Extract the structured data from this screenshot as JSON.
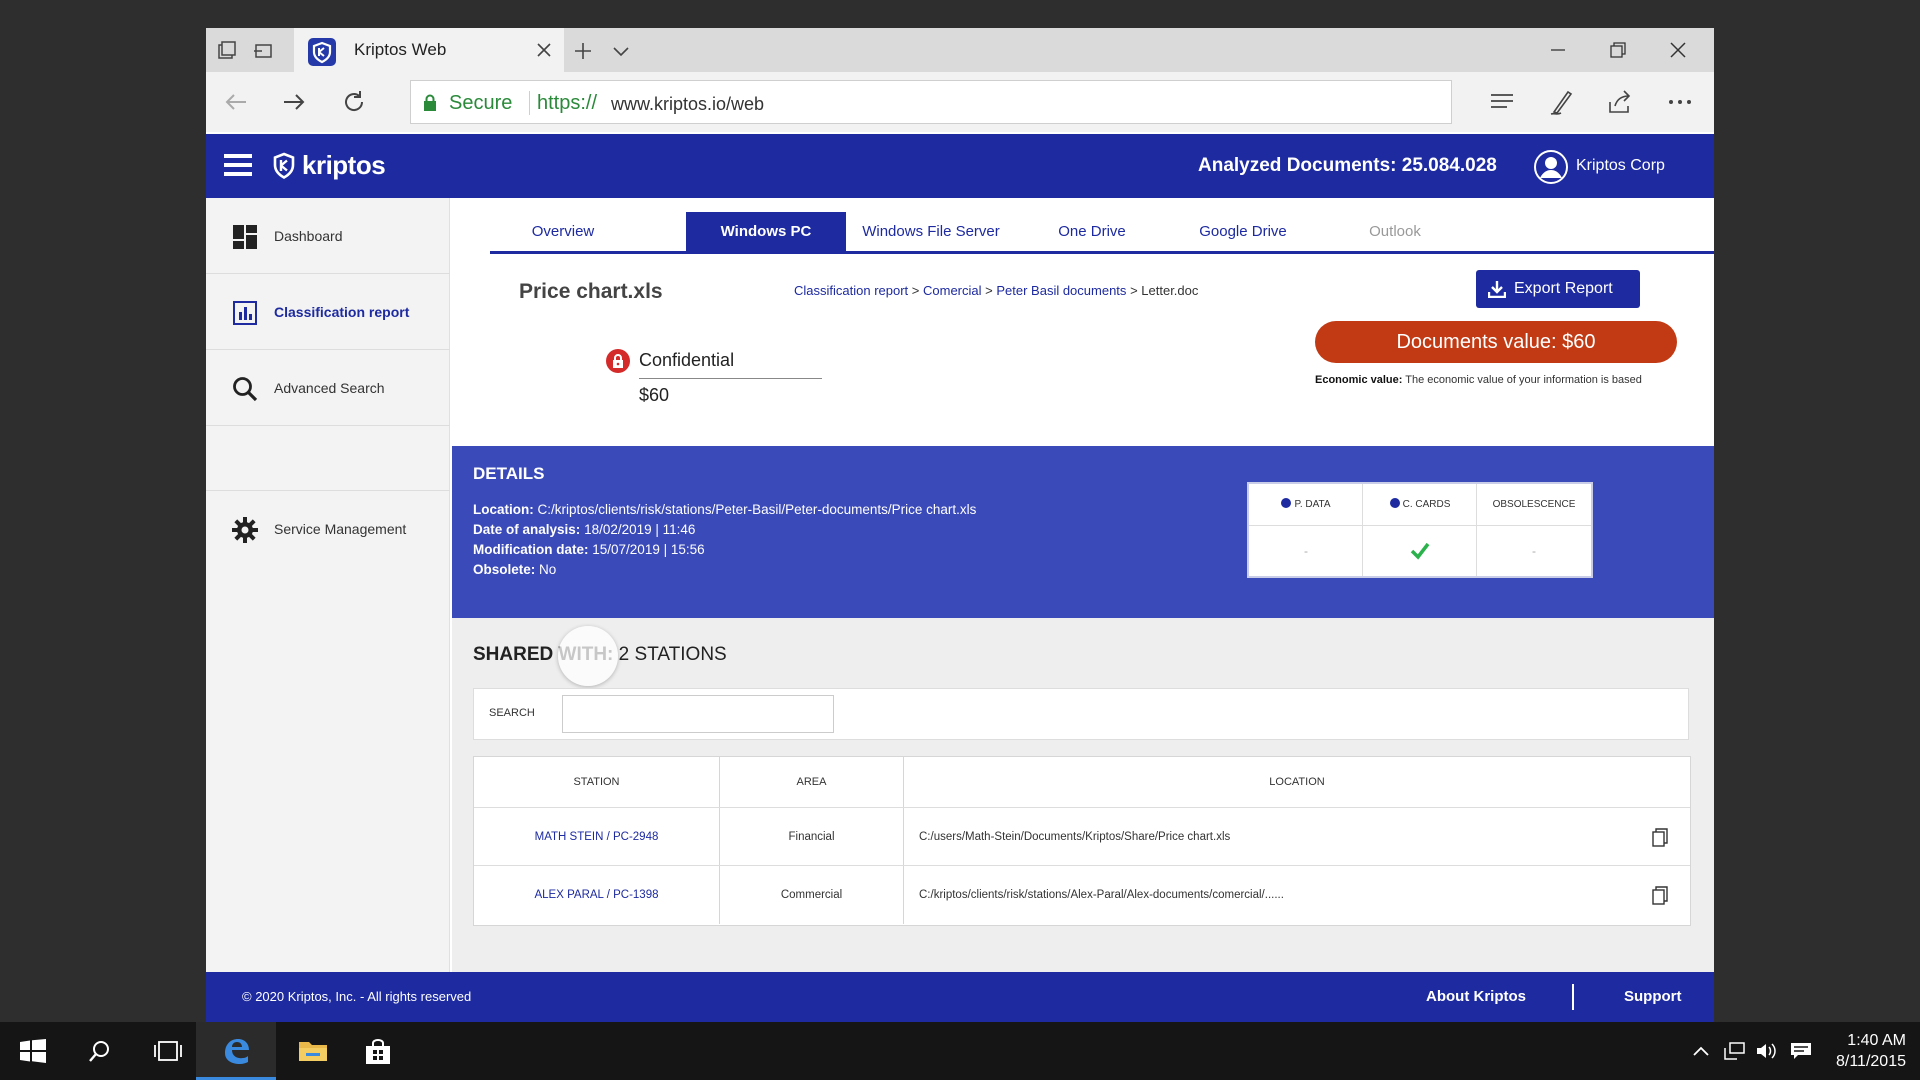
{
  "browser": {
    "tab_title": "Kriptos Web",
    "secure_label": "Secure",
    "url_protocol": "https://",
    "url_host": "www.kriptos.io/web"
  },
  "app": {
    "brand": "kriptos",
    "analyzed_label": "Analyzed Documents: 25.084.028",
    "user_name": "Kriptos Corp"
  },
  "sidebar": {
    "items": [
      {
        "label": "Dashboard",
        "icon": "dashboard-icon"
      },
      {
        "label": "Classification report",
        "icon": "bar-chart-icon",
        "active": true
      },
      {
        "label": "Advanced Search",
        "icon": "search-icon"
      },
      {
        "label": "Service Management",
        "icon": "gear-icon"
      }
    ]
  },
  "tabs": [
    {
      "label": "Overview"
    },
    {
      "label": "Windows PC",
      "active": true
    },
    {
      "label": "Windows File Server"
    },
    {
      "label": "One Drive"
    },
    {
      "label": "Google Drive"
    },
    {
      "label": "Outlook",
      "disabled": true
    }
  ],
  "document": {
    "file_name": "Price chart.xls",
    "breadcrumb": [
      "Classification report",
      "Comercial",
      "Peter Basil documents",
      "Letter.doc"
    ],
    "export_label": "Export Report",
    "classification": "Confidential",
    "value": "$60",
    "documents_value": "Documents value: $60",
    "economic_label": "Economic value:",
    "economic_text": "The economic value of your information is based"
  },
  "details": {
    "title": "DETAILS",
    "location_label": "Location:",
    "location": "C:/kriptos/clients/risk/stations/Peter-Basil/Peter-documents/Price chart.xls",
    "analysis_label": "Date of analysis:",
    "analysis": "18/02/2019 | 11:46",
    "modification_label": "Modification date:",
    "modification": "15/07/2019 | 15:56",
    "obsolete_label": "Obsolete:",
    "obsolete": "No",
    "tags": [
      {
        "label": "P. DATA",
        "value": "-"
      },
      {
        "label": "C. CARDS",
        "value": "check"
      },
      {
        "label": "OBSOLESCENCE",
        "value": "-"
      }
    ]
  },
  "shared": {
    "title_bold": "SHARED WITH:",
    "title_rest": "2 STATIONS",
    "search_label": "SEARCH",
    "search_value": "",
    "columns": [
      "STATION",
      "AREA",
      "LOCATION"
    ],
    "rows": [
      {
        "station": "MATH STEIN / PC-2948",
        "area": "Financial",
        "location": "C:/users/Math-Stein/Documents/Kriptos/Share/Price chart.xls"
      },
      {
        "station": "ALEX PARAL / PC-1398",
        "area": "Commercial",
        "location": "C:/kriptos/clients/risk/stations/Alex-Paral/Alex-documents/comercial/......"
      }
    ]
  },
  "footer": {
    "copyright": "© 2020 Kriptos, Inc. - All rights reserved",
    "about": "About Kriptos",
    "support": "Support"
  },
  "taskbar": {
    "time": "1:40 AM",
    "date": "8/11/2015"
  },
  "colors": {
    "brand_blue": "#1d2aa0",
    "details_blue": "#3a4ab8",
    "value_red": "#c13a14",
    "confidential_red": "#d42a2a",
    "check_green": "#2bb24c"
  }
}
